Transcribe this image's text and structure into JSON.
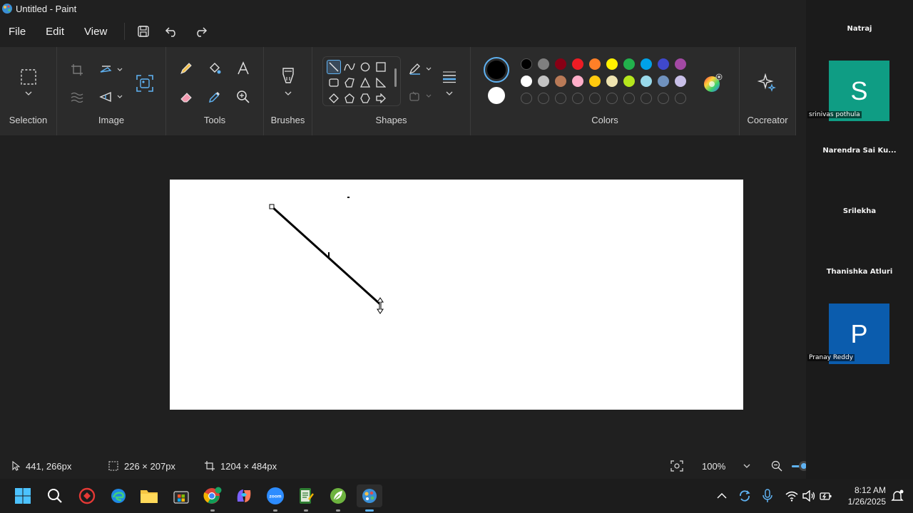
{
  "window": {
    "title": "Untitled - Paint"
  },
  "menu": {
    "file": "File",
    "edit": "Edit",
    "view": "View"
  },
  "ribbon": {
    "selection_label": "Selection",
    "image_label": "Image",
    "tools_label": "Tools",
    "brushes_label": "Brushes",
    "shapes_label": "Shapes",
    "colors_label": "Colors",
    "cocreator_label": "Cocreator"
  },
  "colors": {
    "primary": "#000000",
    "secondary": "#ffffff",
    "palette_row1": [
      "#000000",
      "#7f7f7f",
      "#880015",
      "#ed1c24",
      "#ff7f27",
      "#fff200",
      "#22b14c",
      "#00a2e8",
      "#3f48cc",
      "#a349a4"
    ],
    "palette_row2": [
      "#ffffff",
      "#c3c3c3",
      "#b97a57",
      "#ffaec9",
      "#ffc90e",
      "#efe4b0",
      "#b5e61d",
      "#99d9ea",
      "#7092be",
      "#c8bfe7"
    ],
    "palette_row3_empty": 10,
    "accent": "#5fb2f2"
  },
  "status": {
    "cursor_position": "441, 266px",
    "selection_size": "226 × 207px",
    "canvas_size": "1204 × 484px",
    "zoom": "100%",
    "zoom_slider_fraction": 0.13
  },
  "taskbar": {
    "time": "8:12 AM",
    "date": "1/26/2025"
  },
  "participants": {
    "p1_name": "Natraj",
    "p2_initial": "S",
    "p2_name": "srinivas pothula",
    "p3_name": "Narendra Sai Ku...",
    "p4_name": "Srilekha",
    "p5_name": "Thanishka Atluri",
    "p6_initial": "P",
    "p6_name": "Pranay Reddy",
    "p2_color": "#0f9d84",
    "p6_color": "#0b5cad"
  }
}
